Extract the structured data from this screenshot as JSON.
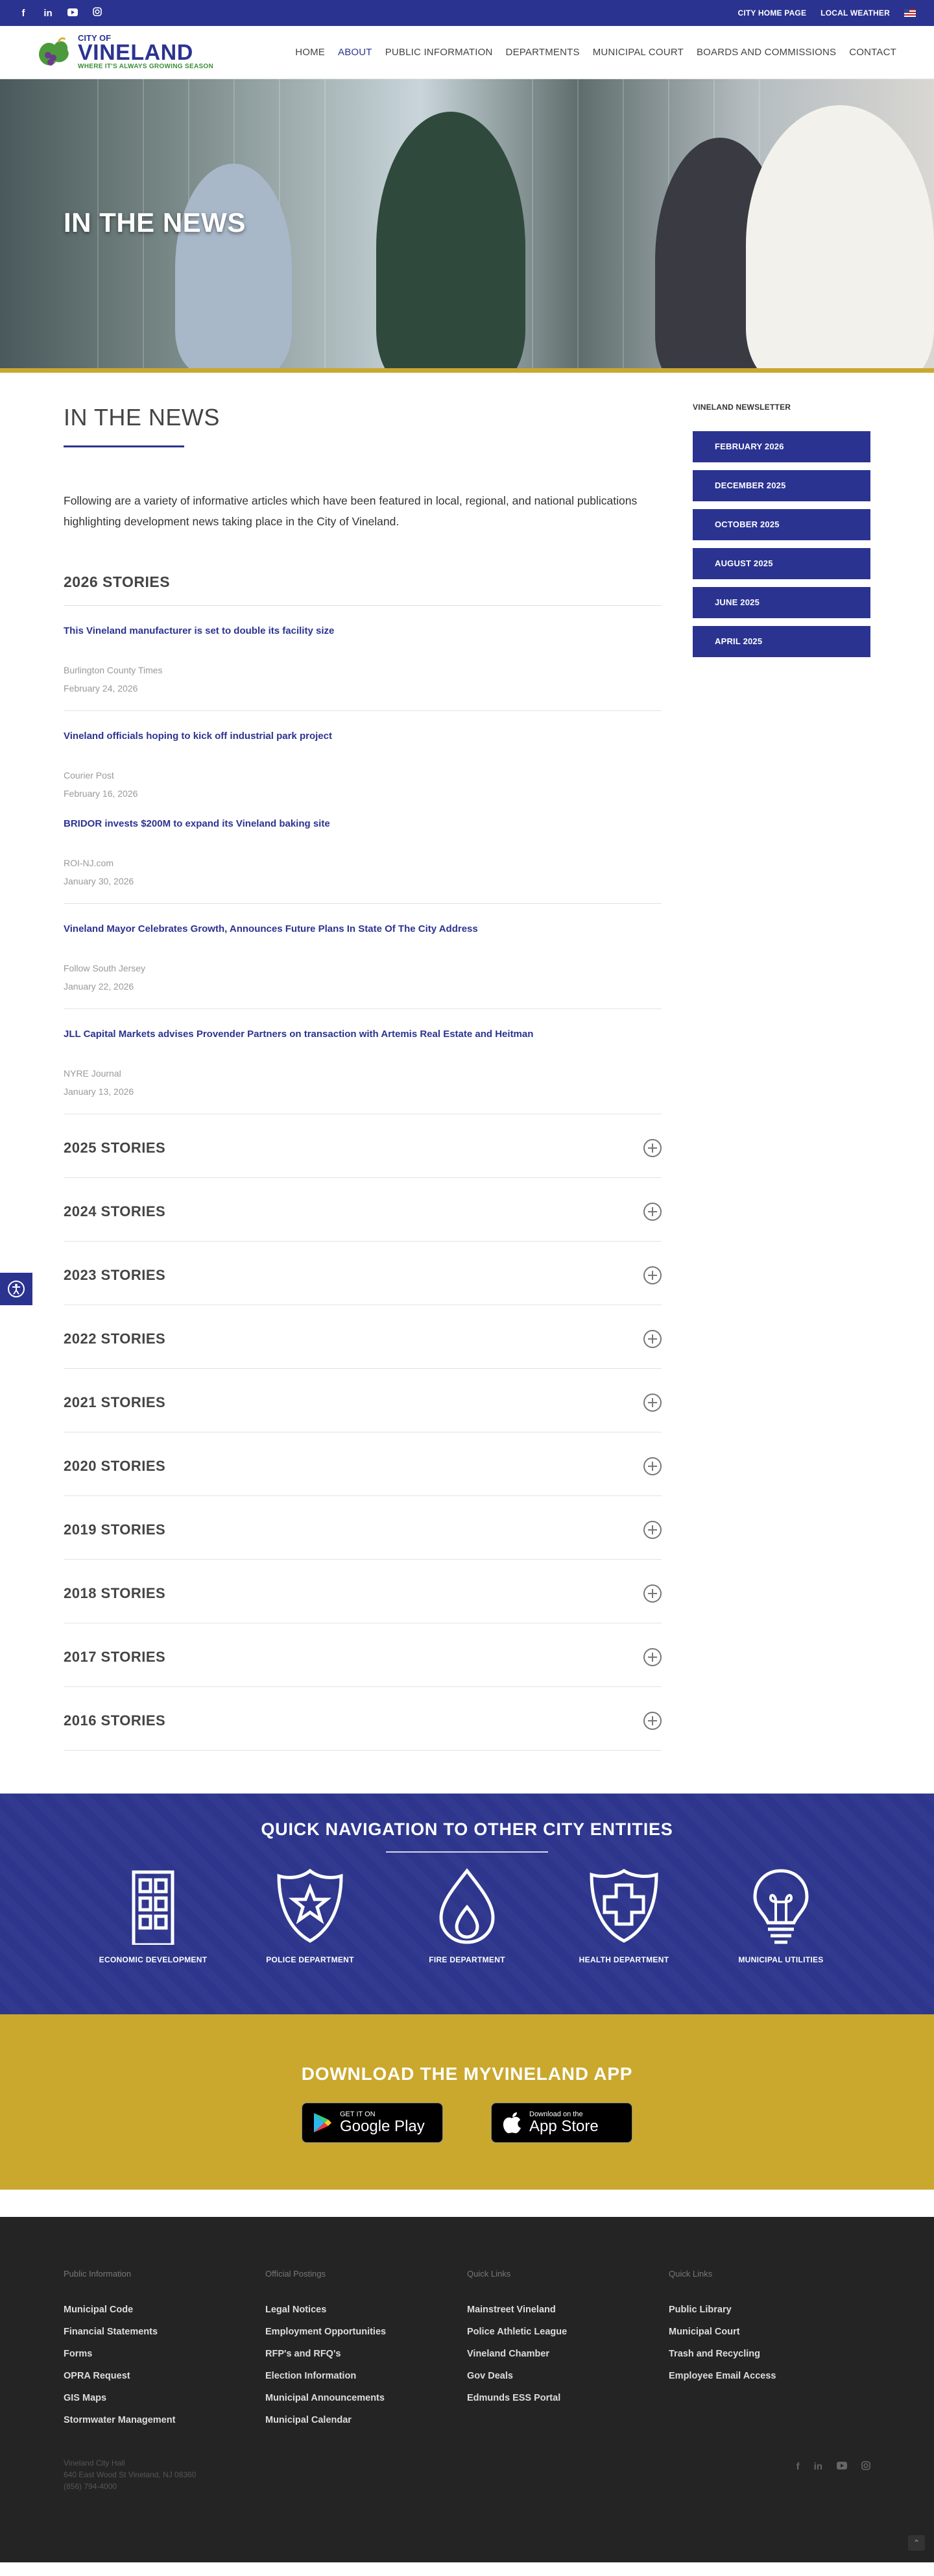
{
  "topbar": {
    "links": [
      "CITY HOME PAGE",
      "LOCAL WEATHER"
    ]
  },
  "logo": {
    "small": "CITY OF",
    "big": "VINELAND",
    "tag": "WHERE IT'S ALWAYS GROWING SEASON"
  },
  "nav": [
    "HOME",
    "ABOUT",
    "PUBLIC INFORMATION",
    "DEPARTMENTS",
    "MUNICIPAL COURT",
    "BOARDS AND COMMISSIONS",
    "CONTACT"
  ],
  "hero": {
    "title": "IN THE NEWS"
  },
  "page": {
    "heading": "IN THE NEWS",
    "intro": "Following are a variety of informative articles which have been featured in local, regional, and national publications highlighting development news taking place in the City of Vineland.",
    "current_year": "2026 STORIES",
    "stories": [
      {
        "title": "This Vineland manufacturer is set to double its facility size",
        "source": "Burlington County Times",
        "date": "February 24, 2026"
      },
      {
        "title": "Vineland officials hoping to kick off industrial park project",
        "source": "Courier Post",
        "date": "February 16, 2026"
      },
      {
        "title": "BRIDOR invests $200M to expand its Vineland baking site",
        "source": "ROI-NJ.com",
        "date": "January 30, 2026"
      },
      {
        "title": "Vineland Mayor Celebrates Growth, Announces Future Plans In State Of The City Address",
        "source": "Follow South Jersey",
        "date": "January 22, 2026"
      },
      {
        "title": "JLL Capital Markets advises Provender Partners on transaction with Artemis Real Estate and Heitman",
        "source": "NYRE Journal",
        "date": "January 13, 2026"
      }
    ],
    "years": [
      "2025 STORIES",
      "2024 STORIES",
      "2023 STORIES",
      "2022 STORIES",
      "2021 STORIES",
      "2020 STORIES",
      "2019 STORIES",
      "2018 STORIES",
      "2017 STORIES",
      "2016 STORIES"
    ]
  },
  "sidebar": {
    "heading": "VINELAND NEWSLETTER",
    "buttons": [
      "FEBRUARY 2026",
      "DECEMBER 2025",
      "OCTOBER 2025",
      "AUGUST 2025",
      "JUNE 2025",
      "APRIL 2025"
    ]
  },
  "quicknav": {
    "title": "QUICK NAVIGATION TO OTHER CITY ENTITIES",
    "items": [
      "ECONOMIC DEVELOPMENT",
      "POLICE DEPARTMENT",
      "FIRE DEPARTMENT",
      "HEALTH DEPARTMENT",
      "MUNICIPAL UTILITIES"
    ]
  },
  "app": {
    "title": "DOWNLOAD THE MYVINELAND APP",
    "google": {
      "line1": "GET IT ON",
      "line2": "Google Play"
    },
    "apple": {
      "line1": "Download on the",
      "line2": "App Store"
    }
  },
  "footer": {
    "cols": [
      {
        "heading": "Public Information",
        "links": [
          "Municipal Code",
          "Financial Statements",
          "Forms",
          "OPRA Request",
          "GIS Maps",
          "Stormwater Management"
        ]
      },
      {
        "heading": "Official Postings",
        "links": [
          "Legal Notices",
          "Employment Opportunities",
          "RFP's and RFQ's",
          "Election Information",
          "Municipal Announcements",
          "Municipal Calendar"
        ]
      },
      {
        "heading": "Quick Links",
        "links": [
          "Mainstreet Vineland",
          "Police Athletic League",
          "Vineland Chamber",
          "Gov Deals",
          "Edmunds ESS Portal"
        ]
      },
      {
        "heading": "Quick Links",
        "links": [
          "Public Library",
          "Municipal Court",
          "Trash and Recycling",
          "Employee Email Access"
        ]
      }
    ],
    "address": [
      "Vineland City Hall",
      "640 East Wood St Vineland, NJ 08360",
      "(856) 794-4000"
    ]
  },
  "colors": {
    "brand_blue": "#2b3391",
    "gold": "#c8a82f",
    "footer": "#242424"
  }
}
